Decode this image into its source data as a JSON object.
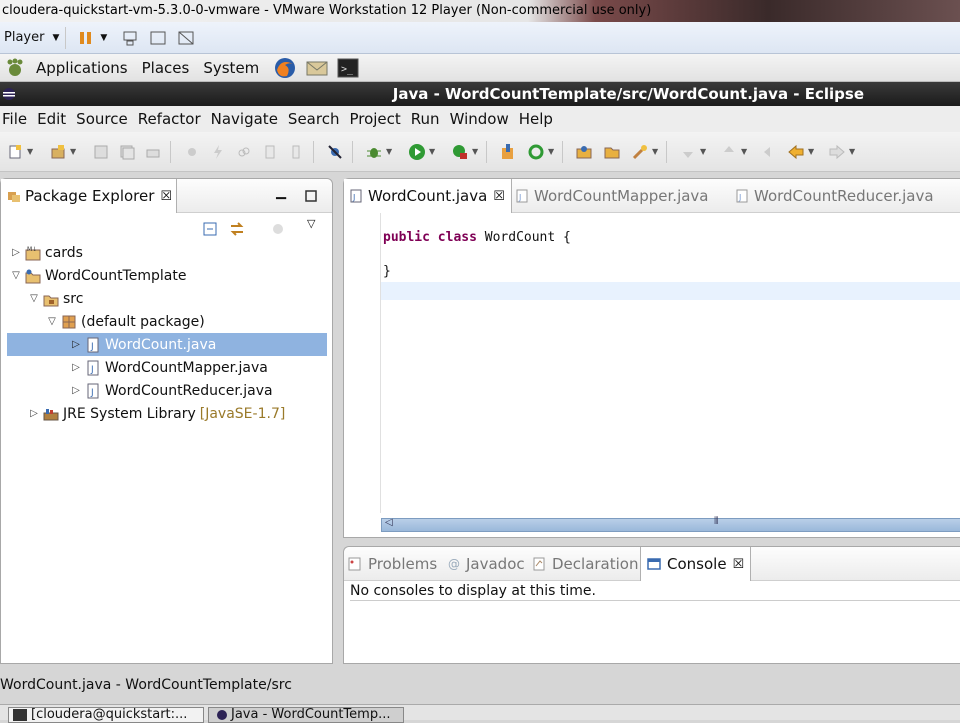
{
  "vm_window": {
    "title": "cloudera-quickstart-vm-5.3.0-0-vmware - VMware Workstation 12 Player (Non-commercial use only)"
  },
  "vm_toolbar": {
    "player_menu": "Player"
  },
  "gnome_panel": {
    "items": [
      "Applications",
      "Places",
      "System"
    ]
  },
  "eclipse": {
    "title": "Java - WordCountTemplate/src/WordCount.java - Eclipse",
    "menu": [
      "File",
      "Edit",
      "Source",
      "Refactor",
      "Navigate",
      "Search",
      "Project",
      "Run",
      "Window",
      "Help"
    ]
  },
  "package_explorer": {
    "title": "Package Explorer",
    "tree": {
      "cards": "cards",
      "project": "WordCountTemplate",
      "src": "src",
      "package": "(default package)",
      "files": [
        "WordCount.java",
        "WordCountMapper.java",
        "WordCountReducer.java"
      ],
      "jre": "JRE System Library",
      "jre_version": "[JavaSE-1.7]"
    }
  },
  "editor": {
    "tabs": [
      "WordCount.java",
      "WordCountMapper.java",
      "WordCountReducer.java"
    ],
    "code": {
      "kw1": "public",
      "kw2": "class",
      "classname": "WordCount {",
      "close": "}"
    }
  },
  "bottom_panel": {
    "tabs": [
      "Problems",
      "Javadoc",
      "Declaration",
      "Console"
    ],
    "console_message": "No consoles to display at this time."
  },
  "status_bar": {
    "text": "WordCount.java - WordCountTemplate/src"
  },
  "taskbar": {
    "items": [
      "[cloudera@quickstart:...",
      "Java - WordCountTemp..."
    ]
  },
  "colors": {
    "selection": "#8fb3e0",
    "keyword": "#7f0055",
    "current_line": "#e8f2fe"
  }
}
